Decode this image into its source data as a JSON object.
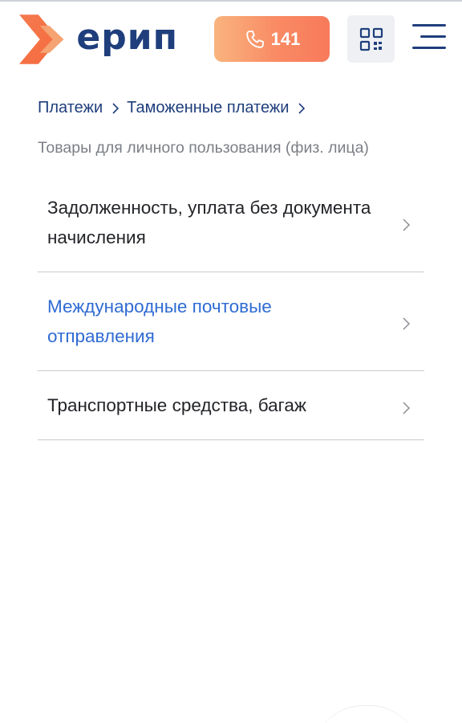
{
  "header": {
    "logo_text": "ерип",
    "call_number": "141"
  },
  "breadcrumb": {
    "items": [
      "Платежи",
      "Таможенные платежи"
    ]
  },
  "subtitle": "Товары для личного пользования (физ. лица)",
  "list": {
    "items": [
      {
        "label": "Задолженность, уплата без документа начисления"
      },
      {
        "label": "Международные почтовые отправления"
      },
      {
        "label": "Транспортные средства, багаж"
      }
    ]
  },
  "colors": {
    "brand_blue": "#1f3e7c",
    "accent_orange": "#f98a64",
    "link_blue": "#2f6bd3"
  },
  "icons": [
    "logo-chevron-icon",
    "phone-icon",
    "qr-code-icon",
    "hamburger-menu-icon",
    "chevron-right-icon"
  ]
}
